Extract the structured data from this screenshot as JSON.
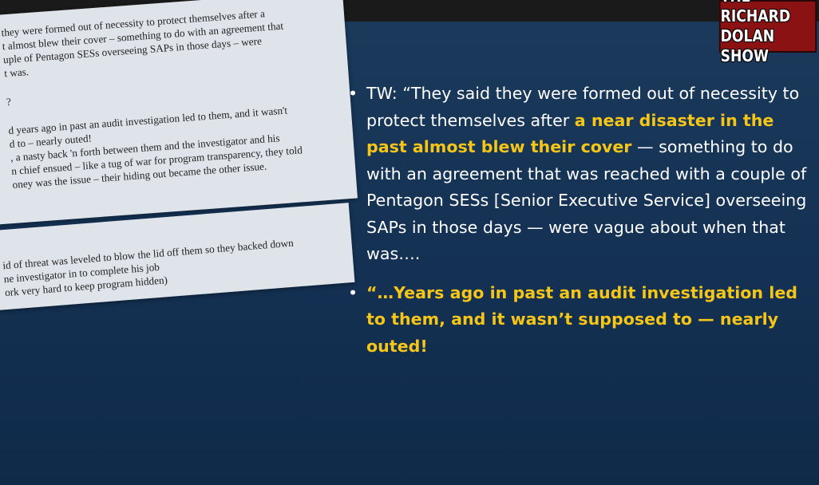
{
  "logo": {
    "line1": "THE RICHARD",
    "line2": "DOLAN SHOW"
  },
  "document_top": [
    "they were formed out of necessity to protect themselves after a",
    "t almost blew their cover – something to do with an agreement that",
    "uple of Pentagon SESs overseeing SAPs in those days – were",
    "t was.",
    "",
    "?",
    "",
    "d years ago in past an audit investigation led to them, and it wasn't",
    "d to – nearly outed!",
    ", a nasty back 'n forth between them and the investigator and his",
    "n chief ensued – like a tug of war for program transparency, they told",
    "oney was the issue – their hiding out became the other issue."
  ],
  "document_bottom": [
    "id of threat was leveled to blow the lid off them so they backed down",
    "ne investigator in to complete his job",
    "ork very hard to keep program hidden)"
  ],
  "bullets": {
    "bullet_char": "•",
    "b1_part1": "TW: “They said they were formed out of necessity to protect themselves after ",
    "b1_highlight": "a near disaster in the past almost blew their cover",
    "b1_part2": " — something to do with an agreement that was reached with a couple of Pentagon SESs [Senior Executive Service] overseeing SAPs in those days — were vague about when that was….",
    "b2_part1": "“…",
    "b2_highlight": "Years ago in past an audit investigation led to them, and it wasn’t supposed to — nearly outed!"
  }
}
